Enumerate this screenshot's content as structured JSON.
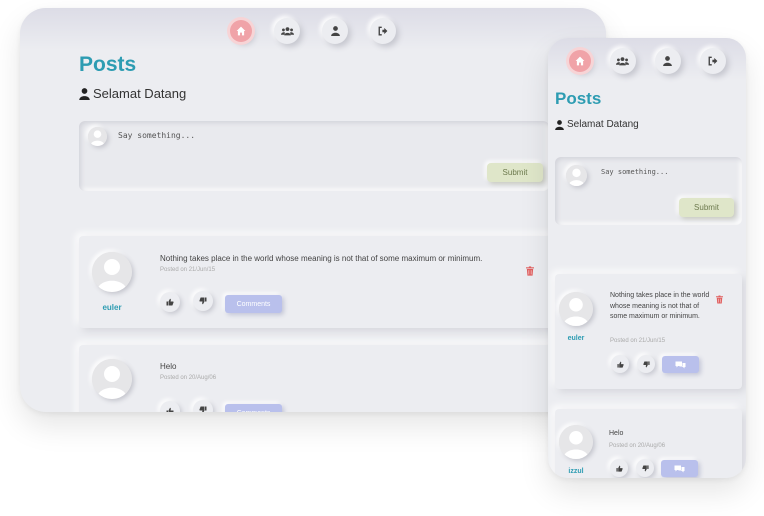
{
  "nav": {
    "items": [
      {
        "icon": "home-icon",
        "active": true
      },
      {
        "icon": "users-icon",
        "active": false
      },
      {
        "icon": "user-icon",
        "active": false
      },
      {
        "icon": "sign-out-icon",
        "active": false
      }
    ]
  },
  "page": {
    "title": "Posts",
    "welcome": "Selamat Datang"
  },
  "composer": {
    "placeholder": "Say something...",
    "submit_label": "Submit"
  },
  "posts": [
    {
      "author": "euler",
      "text": "Nothing takes place in the world whose meaning is not that of some maximum or minimum.",
      "date": "Posted on 21/Jun/15",
      "comments_label": "Comments",
      "deletable": true
    },
    {
      "author": "izzul",
      "text": "Helo",
      "date": "Posted on 20/Aug/06",
      "comments_label": "Comments",
      "deletable": false
    }
  ],
  "colors": {
    "accent": "#2d9cb2",
    "active_nav": "#f0a3a8",
    "submit": "#dfe6c9",
    "comments": "#b9c0ec",
    "delete": "#e06060"
  }
}
